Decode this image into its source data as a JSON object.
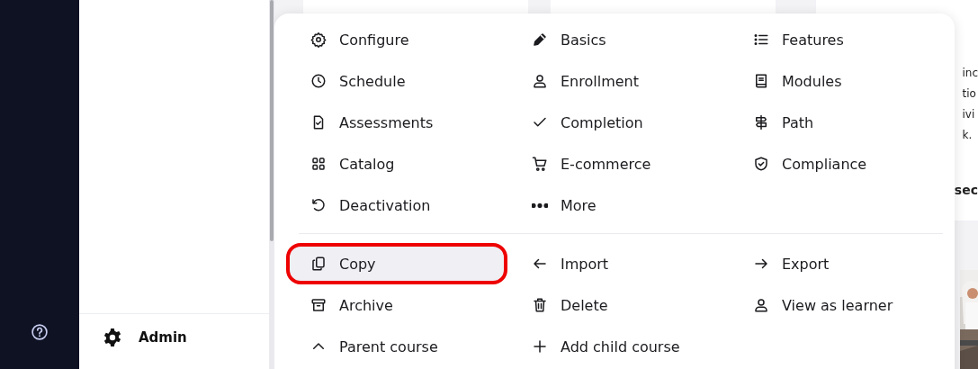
{
  "sidebar": {
    "admin_label": "Admin"
  },
  "background_card": {
    "text_fragments": [
      "inc",
      "tio",
      "ivi",
      "k."
    ],
    "footer_fragment": "sec"
  },
  "menu": {
    "sections": [
      {
        "items": [
          {
            "label": "Configure",
            "highlighted": false
          },
          {
            "label": "Basics",
            "highlighted": false
          },
          {
            "label": "Features",
            "highlighted": false
          },
          {
            "label": "Schedule",
            "highlighted": false
          },
          {
            "label": "Enrollment",
            "highlighted": false
          },
          {
            "label": "Modules",
            "highlighted": false
          },
          {
            "label": "Assessments",
            "highlighted": false
          },
          {
            "label": "Completion",
            "highlighted": false
          },
          {
            "label": "Path",
            "highlighted": false
          },
          {
            "label": "Catalog",
            "highlighted": false
          },
          {
            "label": "E-commerce",
            "highlighted": false
          },
          {
            "label": "Compliance",
            "highlighted": false
          },
          {
            "label": "Deactivation",
            "highlighted": false
          },
          {
            "label": "More",
            "highlighted": false
          }
        ]
      },
      {
        "items": [
          {
            "label": "Copy",
            "highlighted": true
          },
          {
            "label": "Import",
            "highlighted": false
          },
          {
            "label": "Export",
            "highlighted": false
          },
          {
            "label": "Archive",
            "highlighted": false
          },
          {
            "label": "Delete",
            "highlighted": false
          },
          {
            "label": "View as learner",
            "highlighted": false
          },
          {
            "label": "Parent course",
            "highlighted": false
          },
          {
            "label": "Add child course",
            "highlighted": false
          }
        ]
      }
    ]
  }
}
